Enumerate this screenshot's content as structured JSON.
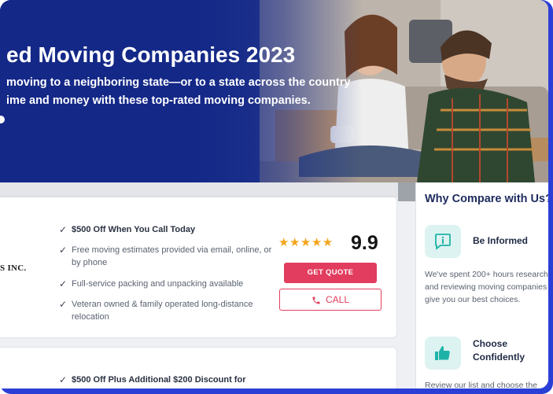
{
  "hero": {
    "title": "ed Moving Companies 2023",
    "subtitle_line1": "moving to a neighboring state—or to a state across the country",
    "subtitle_line2": "ime and money with these top-rated moving companies."
  },
  "listings": [
    {
      "company_name": "S INC.",
      "features": [
        "$500 Off When You Call Today",
        "Free moving estimates provided via email, online, or by phone",
        "Full-service packing and unpacking available",
        "Veteran owned & family operated long-distance relocation"
      ],
      "stars": "★★★★★",
      "rating": "9.9",
      "quote_label": "GET QUOTE",
      "call_label": "CALL"
    },
    {
      "features": [
        "$500 Off Plus Additional $200 Discount for"
      ]
    }
  ],
  "sidebar": {
    "title": "Why Compare with Us?",
    "items": [
      {
        "icon": "info-chat-icon",
        "heading": "Be Informed",
        "text_lines": [
          "We've spent 200+ hours researching",
          "and reviewing moving companies t",
          "give you our best choices."
        ]
      },
      {
        "icon": "thumbs-up-icon",
        "heading_line1": "Choose",
        "heading_line2": "Confidently",
        "text_lines": [
          "Review our list and choose the"
        ]
      }
    ]
  },
  "colors": {
    "frame": "#2b3fd6",
    "hero_blue": "#162c86",
    "accent_red": "#e23d5e",
    "star": "#f4a51c",
    "teal_bg": "#ddf3f1",
    "teal_icon": "#1fb3a8"
  }
}
